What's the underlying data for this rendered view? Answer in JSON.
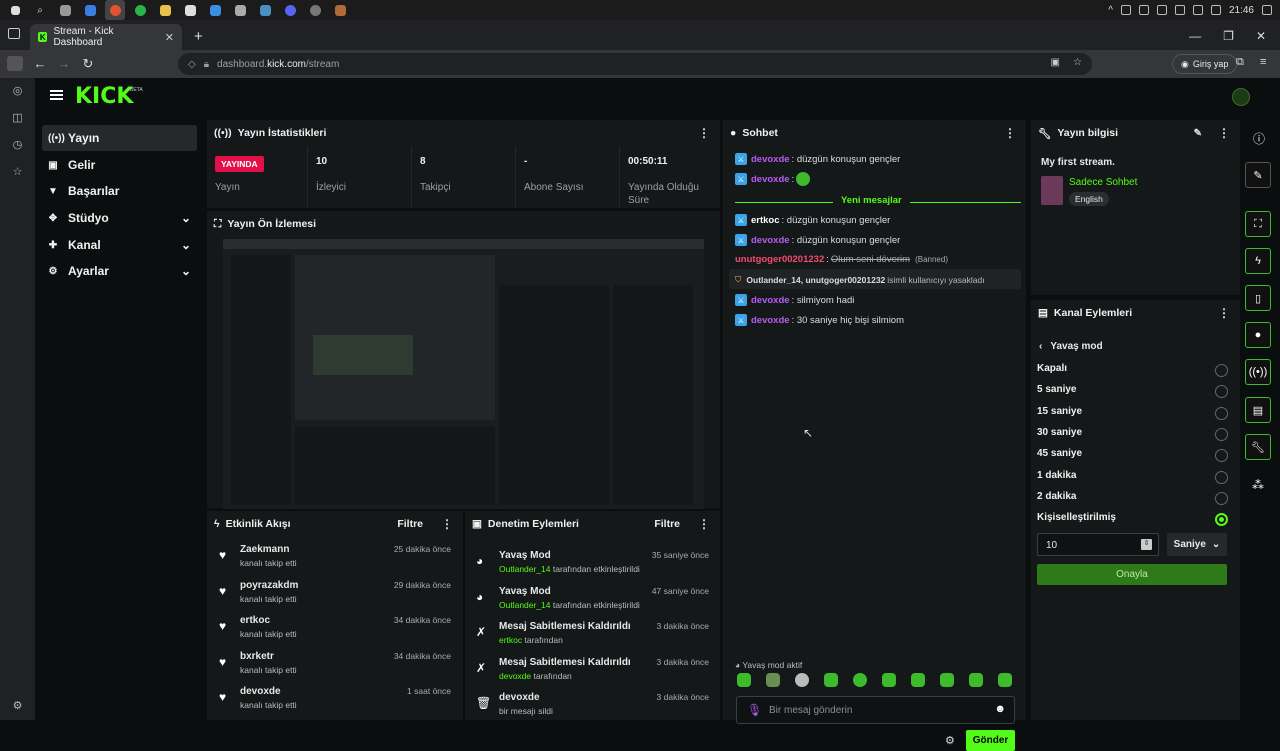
{
  "os": {
    "clock": "21:46"
  },
  "browser": {
    "tab_title": "Stream - Kick Dashboard",
    "url_prefix": "dashboard.",
    "url_host": "kick.com",
    "url_path": "/stream",
    "login_label": "Giriş yap"
  },
  "app": {
    "logo": "KICK",
    "beta": "BETA"
  },
  "nav": [
    {
      "label": "Yayın",
      "icon": "broadcast-icon",
      "active": true
    },
    {
      "label": "Gelir",
      "icon": "money-icon"
    },
    {
      "label": "Başarılar",
      "icon": "trophy-icon"
    },
    {
      "label": "Stüdyo",
      "icon": "studio-icon",
      "expandable": true
    },
    {
      "label": "Kanal",
      "icon": "channel-icon",
      "expandable": true
    },
    {
      "label": "Ayarlar",
      "icon": "gear-icon",
      "expandable": true
    }
  ],
  "stats": {
    "title": "Yayın İstatistikleri",
    "items": [
      {
        "value": "YAYINDA",
        "label": "Yayın"
      },
      {
        "value": "10",
        "label": "İzleyici"
      },
      {
        "value": "8",
        "label": "Takipçi"
      },
      {
        "value": "-",
        "label": "Abone Sayısı"
      },
      {
        "value": "00:50:11",
        "label": "Yayında Olduğu Süre"
      }
    ]
  },
  "preview": {
    "title": "Yayın Ön İzlemesi"
  },
  "activity": {
    "title": "Etkinlik Akışı",
    "filter": "Filtre",
    "items": [
      {
        "name": "Zaekmann",
        "sub": "kanalı takip etti",
        "time": "25 dakika önce"
      },
      {
        "name": "poyrazakdm",
        "sub": "kanalı takip etti",
        "time": "29 dakika önce"
      },
      {
        "name": "ertkoc",
        "sub": "kanalı takip etti",
        "time": "34 dakika önce"
      },
      {
        "name": "bxrketr",
        "sub": "kanalı takip etti",
        "time": "34 dakika önce"
      },
      {
        "name": "devoxde",
        "sub": "kanalı takip etti",
        "time": "1 saat önce"
      }
    ]
  },
  "moderation": {
    "title": "Denetim Eylemleri",
    "filter": "Filtre",
    "items": [
      {
        "title": "Yavaş Mod",
        "actor": "Outlander_14",
        "sub": " tarafından etkinleştirildi",
        "time": "35 saniye önce"
      },
      {
        "title": "Yavaş Mod",
        "actor": "Outlander_14",
        "sub": " tarafından etkinleştirildi",
        "time": "47 saniye önce"
      },
      {
        "title": "Mesaj Sabitlemesi Kaldırıldı",
        "actor": "ertkoc",
        "sub": " tarafından",
        "time": "3 dakika önce"
      },
      {
        "title": "Mesaj Sabitlemesi Kaldırıldı",
        "actor": "devoxde",
        "sub": " tarafından",
        "time": "3 dakika önce"
      },
      {
        "title": "devoxde",
        "actor": "",
        "sub": "bir mesajı sildi",
        "time": "3 dakika önce"
      }
    ]
  },
  "chat": {
    "title": "Sohbet",
    "new_messages": "Yeni mesajlar",
    "messages": [
      {
        "user": "devoxde",
        "text": ": düzgün konuşun gençler"
      },
      {
        "user": "devoxde",
        "text": ": "
      },
      {
        "user": "ertkoc",
        "text": ": düzgün konuşun gençler"
      },
      {
        "user": "devoxde",
        "text": ": düzgün konuşun gençler"
      },
      {
        "user": "unutgoger00201232",
        "text": ": ",
        "struck": "Olum seni döverim",
        "tag": "(Banned)"
      },
      {
        "system": "Outlander_14, unutgoger00201232",
        "text": " isimli kullanıcıyı yasakladı"
      },
      {
        "user": "devoxde",
        "text": ": silmiyom hadi"
      },
      {
        "user": "devoxde",
        "text": ": 30 saniye hiç bişi silmiom"
      }
    ],
    "slow_mode_notice": "Yavaş mod aktif",
    "input_placeholder": "Bir mesaj gönderin",
    "send_label": "Gönder"
  },
  "stream_info": {
    "title": "Yayın bilgisi",
    "stream_title": "My first stream.",
    "category": "Sadece Sohbet",
    "language": "English"
  },
  "channel_actions": {
    "title": "Kanal Eylemleri",
    "back_label": "Yavaş mod",
    "options": [
      "Kapalı",
      "5 saniye",
      "15 saniye",
      "30 saniye",
      "45 saniye",
      "1 dakika",
      "2 dakika",
      "Kişiselleştirilmiş"
    ],
    "selected_index": 7,
    "custom_value": "10",
    "unit": "Saniye",
    "confirm_label": "Onayla"
  },
  "colors": {
    "accent": "#53fc18",
    "live": "#e30f48",
    "username": "#b75cf0",
    "ban": "#f44b6f"
  }
}
